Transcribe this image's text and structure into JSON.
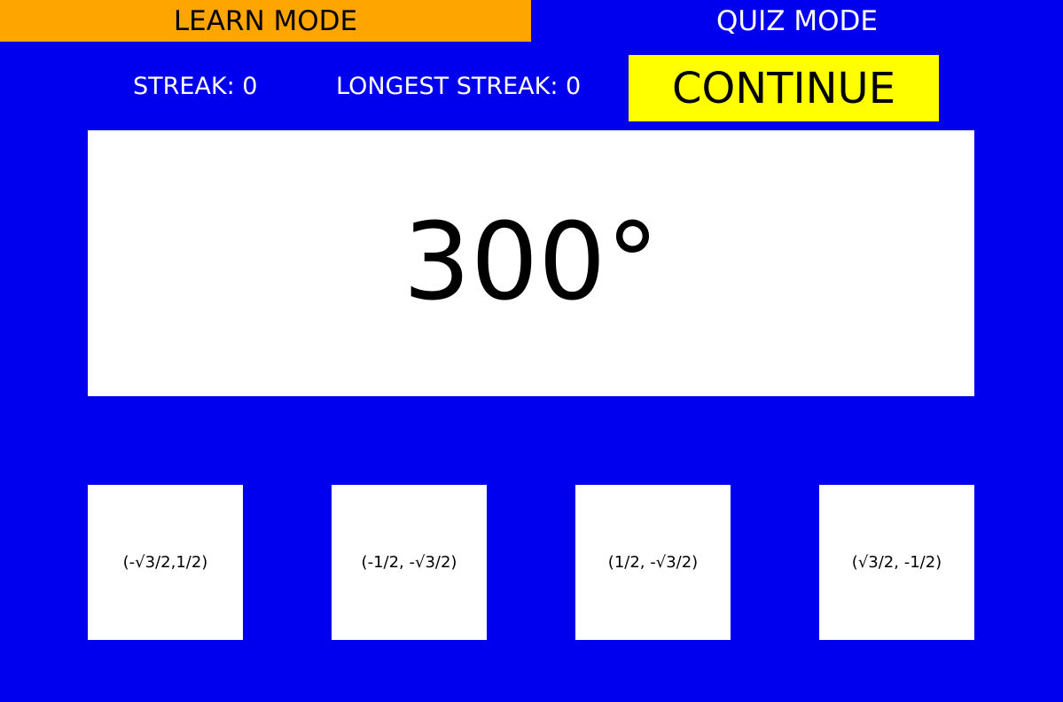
{
  "tabs": {
    "learn_label": "LEARN MODE",
    "quiz_label": "QUIZ MODE"
  },
  "stats": {
    "streak_text": "STREAK: 0",
    "longest_streak_text": "LONGEST STREAK: 0"
  },
  "continue_label": "CONTINUE",
  "question": {
    "angle": "300°"
  },
  "answers": [
    "(-√3/2,1/2)",
    "(-1/2, -√3/2)",
    "(1/2, -√3/2)",
    "(√3/2, -1/2)"
  ],
  "colors": {
    "background": "#0000ee",
    "active_tab": "#ffa500",
    "continue_button": "#ffff00",
    "card": "#ffffff"
  }
}
